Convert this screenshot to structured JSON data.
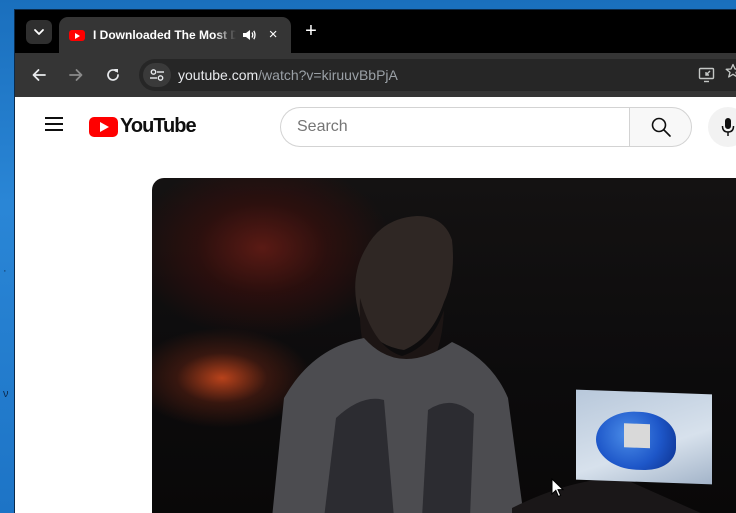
{
  "browser": {
    "tab": {
      "title": "I Downloaded The Most Dangerous",
      "favicon": "youtube-favicon",
      "audio_icon": "speaker-icon",
      "close_label": "×"
    },
    "new_tab_label": "+",
    "omnibox": {
      "host": "youtube.com",
      "path": "/watch?v=kiruuvBbPjA"
    }
  },
  "youtube": {
    "logo_text": "YouTube",
    "search": {
      "placeholder": "Search",
      "value": ""
    }
  },
  "colors": {
    "tabstrip_bg": "#000000",
    "toolbar_bg": "#353535",
    "brand_red": "#ff0000",
    "desktop_blue": "#1c78c4"
  }
}
